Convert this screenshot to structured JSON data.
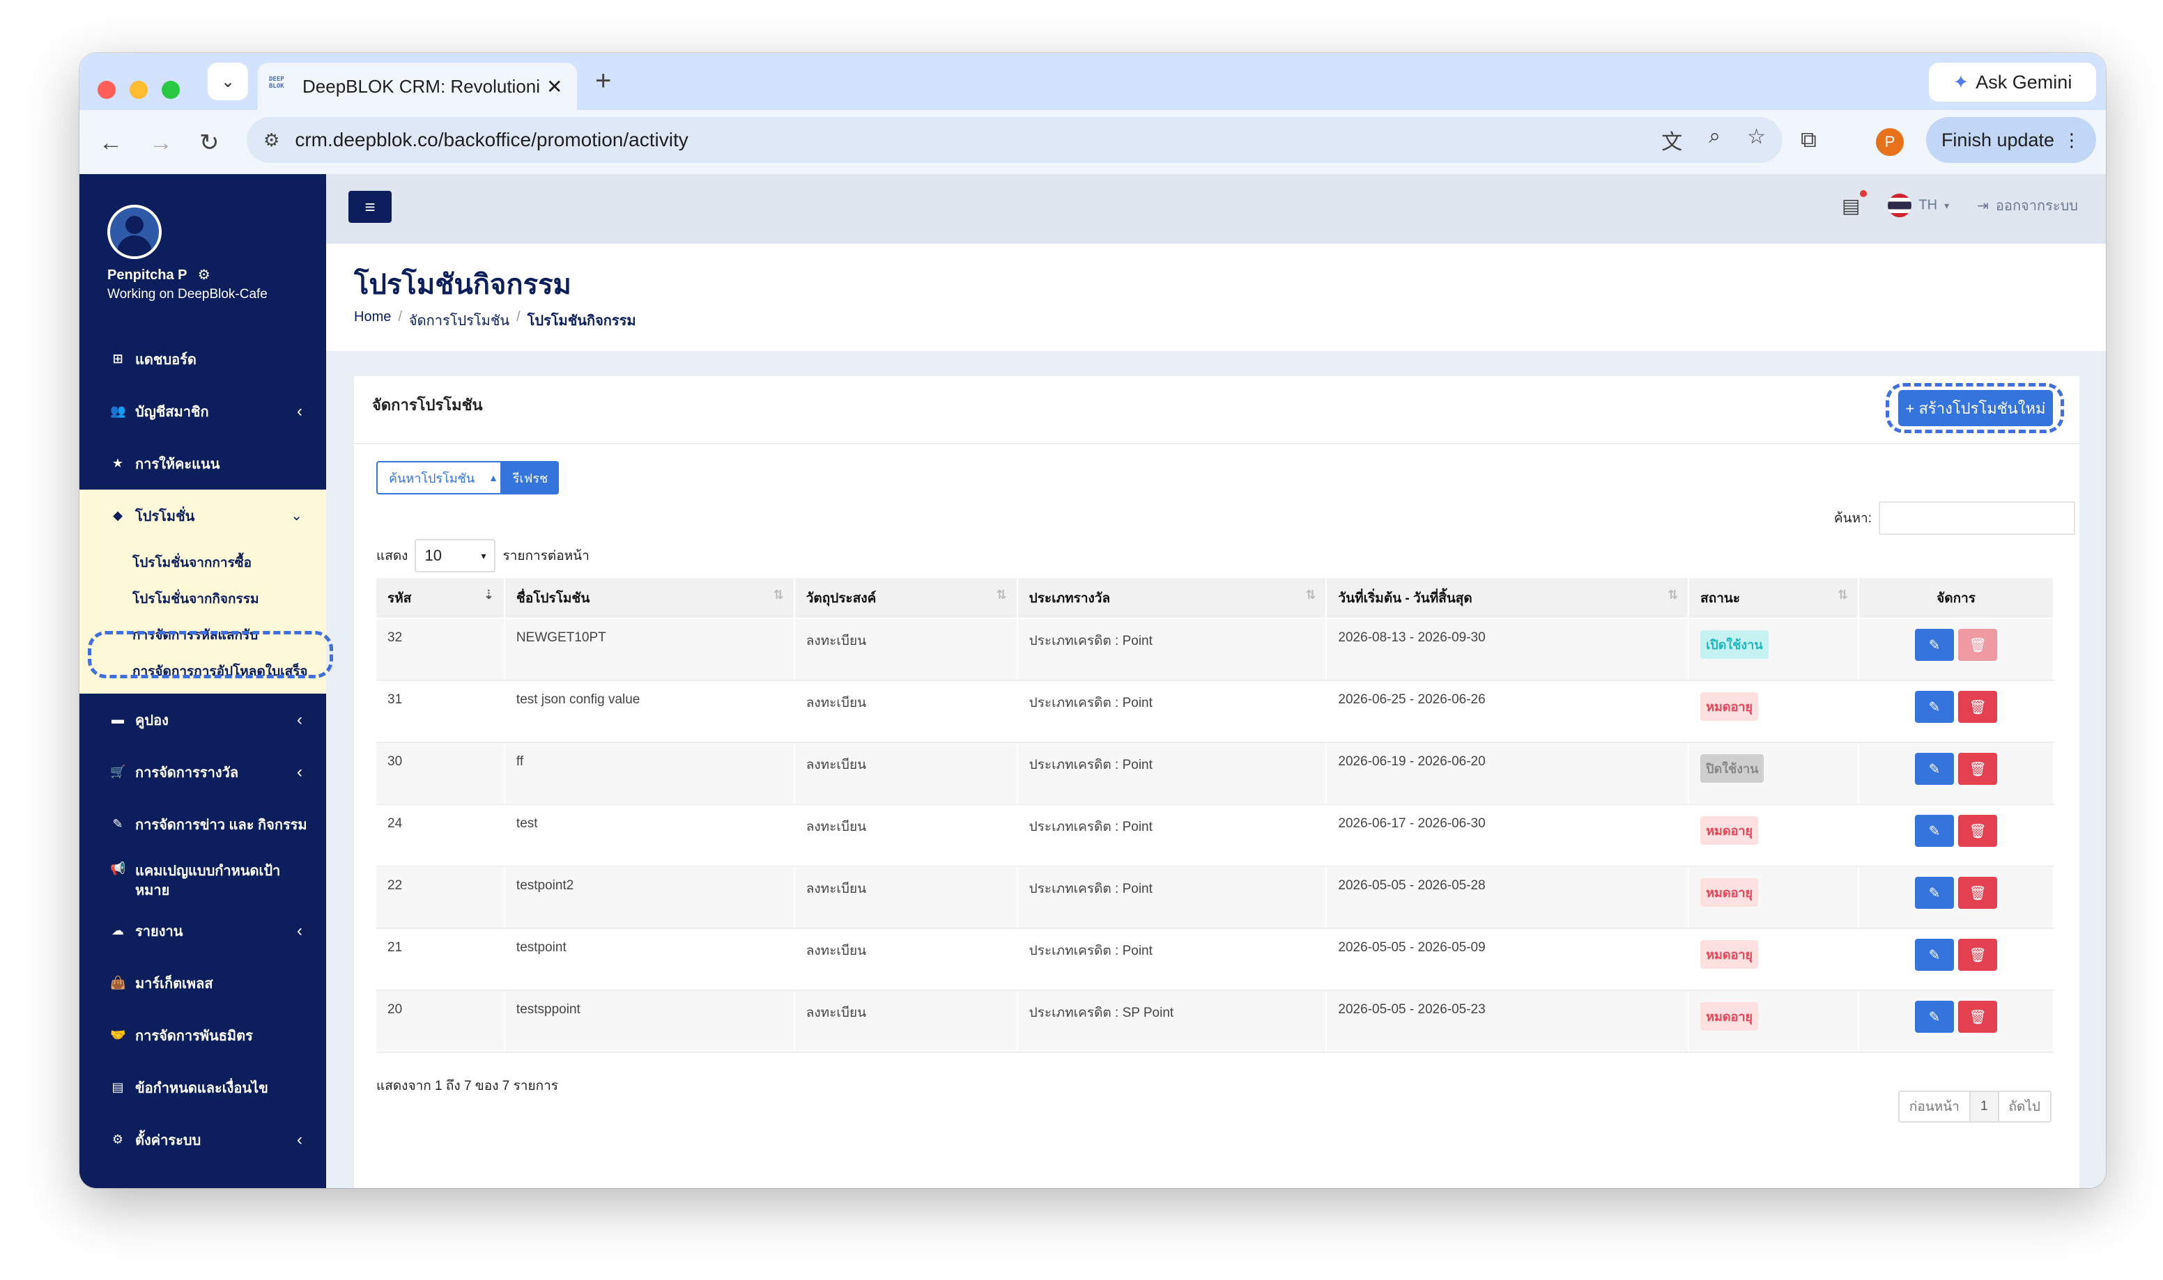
{
  "browser": {
    "tab_title": "DeepBLOK CRM: Revolutioniz",
    "tab_favicon_text": "DEEP BLOK",
    "new_tab_label": "+",
    "ask_gemini": "Ask Gemini",
    "url": "crm.deepblok.co/backoffice/promotion/activity",
    "finish_update": "Finish update",
    "profile_initial": "P"
  },
  "sidebar": {
    "user_name": "Penpitcha P",
    "user_workspace": "Working on DeepBlok-Cafe",
    "items": [
      {
        "label": "แดชบอร์ด",
        "icon": "dashboard-icon",
        "chevron": false
      },
      {
        "label": "บัญชีสมาชิก",
        "icon": "users-icon",
        "chevron": true
      },
      {
        "label": "การให้คะแนน",
        "icon": "star-icon",
        "chevron": false
      },
      {
        "label": "โปรโมชั่น",
        "icon": "tag-icon",
        "chevron": true,
        "active": true
      },
      {
        "label": "คูปอง",
        "icon": "ticket-icon",
        "chevron": true
      },
      {
        "label": "การจัดการรางวัล",
        "icon": "cart-icon",
        "chevron": true
      },
      {
        "label": "การจัดการข่าว และ กิจกรรม",
        "icon": "edit-icon",
        "chevron": false
      },
      {
        "label": "แคมเปญแบบกำหนดเป้าหมาย",
        "icon": "megaphone-icon",
        "chevron": false
      },
      {
        "label": "รายงาน",
        "icon": "cloud-icon",
        "chevron": true
      },
      {
        "label": "มาร์เก็ตเพลส",
        "icon": "bag-icon",
        "chevron": false
      },
      {
        "label": "การจัดการพันธมิตร",
        "icon": "handshake-icon",
        "chevron": false
      },
      {
        "label": "ข้อกำหนดและเงื่อนไข",
        "icon": "document-icon",
        "chevron": false
      },
      {
        "label": "ตั้งค่าระบบ",
        "icon": "gear-icon",
        "chevron": true
      }
    ],
    "submenu": [
      "โปรโมชั่นจากการซื้อ",
      "โปรโมชั่นจากกิจกรรม",
      "การจัดการรหัสแลกรับ",
      "การจัดการการอัปโหลดใบเสร็จ"
    ]
  },
  "topbar": {
    "language": "TH",
    "logout": "ออกจากระบบ"
  },
  "page": {
    "title": "โปรโมชันกิจกรรม",
    "breadcrumb": [
      "Home",
      "จัดการโปรโมชัน",
      "โปรโมชันกิจกรรม"
    ]
  },
  "card": {
    "title": "จัดการโปรโมชัน",
    "new_button": "+ สร้างโปรโมชันใหม่",
    "search_toggle": "ค้นหาโปรโมชัน",
    "refresh": "รีเฟรช",
    "search_label": "ค้นหา:",
    "show_label": "แสดง",
    "page_size": "10",
    "per_page_label": "รายการต่อหน้า",
    "info": "แสดงจาก 1 ถึง 7 ของ 7 รายการ",
    "prev": "ก่อนหน้า",
    "page": "1",
    "next": "ถัดไป"
  },
  "table": {
    "columns": [
      "รหัส",
      "ชื่อโปรโมชัน",
      "วัตถุประสงค์",
      "ประเภทรางวัล",
      "วันที่เริ่มต้น - วันที่สิ้นสุด",
      "สถานะ",
      "จัดการ"
    ],
    "rows": [
      {
        "id": "32",
        "name": "NEWGET10PT",
        "purpose": "ลงทะเบียน",
        "reward": "ประเภทเครดิต : Point",
        "dates": "2026-08-13 - 2026-09-30",
        "status": "เปิดใช้งาน",
        "status_kind": "open"
      },
      {
        "id": "31",
        "name": "test json config value",
        "purpose": "ลงทะเบียน",
        "reward": "ประเภทเครดิต : Point",
        "dates": "2026-06-25 - 2026-06-26",
        "status": "หมดอายุ",
        "status_kind": "expired"
      },
      {
        "id": "30",
        "name": "ff",
        "purpose": "ลงทะเบียน",
        "reward": "ประเภทเครดิต : Point",
        "dates": "2026-06-19 - 2026-06-20",
        "status": "ปิดใช้งาน",
        "status_kind": "off"
      },
      {
        "id": "24",
        "name": "test",
        "purpose": "ลงทะเบียน",
        "reward": "ประเภทเครดิต : Point",
        "dates": "2026-06-17 - 2026-06-30",
        "status": "หมดอายุ",
        "status_kind": "expired"
      },
      {
        "id": "22",
        "name": "testpoint2",
        "purpose": "ลงทะเบียน",
        "reward": "ประเภทเครดิต : Point",
        "dates": "2026-05-05 - 2026-05-28",
        "status": "หมดอายุ",
        "status_kind": "expired"
      },
      {
        "id": "21",
        "name": "testpoint",
        "purpose": "ลงทะเบียน",
        "reward": "ประเภทเครดิต : Point",
        "dates": "2026-05-05 - 2026-05-09",
        "status": "หมดอายุ",
        "status_kind": "expired"
      },
      {
        "id": "20",
        "name": "testsppoint",
        "purpose": "ลงทะเบียน",
        "reward": "ประเภทเครดิต : SP Point",
        "dates": "2026-05-05 - 2026-05-23",
        "status": "หมดอายุ",
        "status_kind": "expired"
      }
    ]
  },
  "colors": {
    "sidebar": "#0c1f5c",
    "accent": "#3474dc",
    "danger": "#e3414f",
    "highlight": "#3e6ee0"
  }
}
